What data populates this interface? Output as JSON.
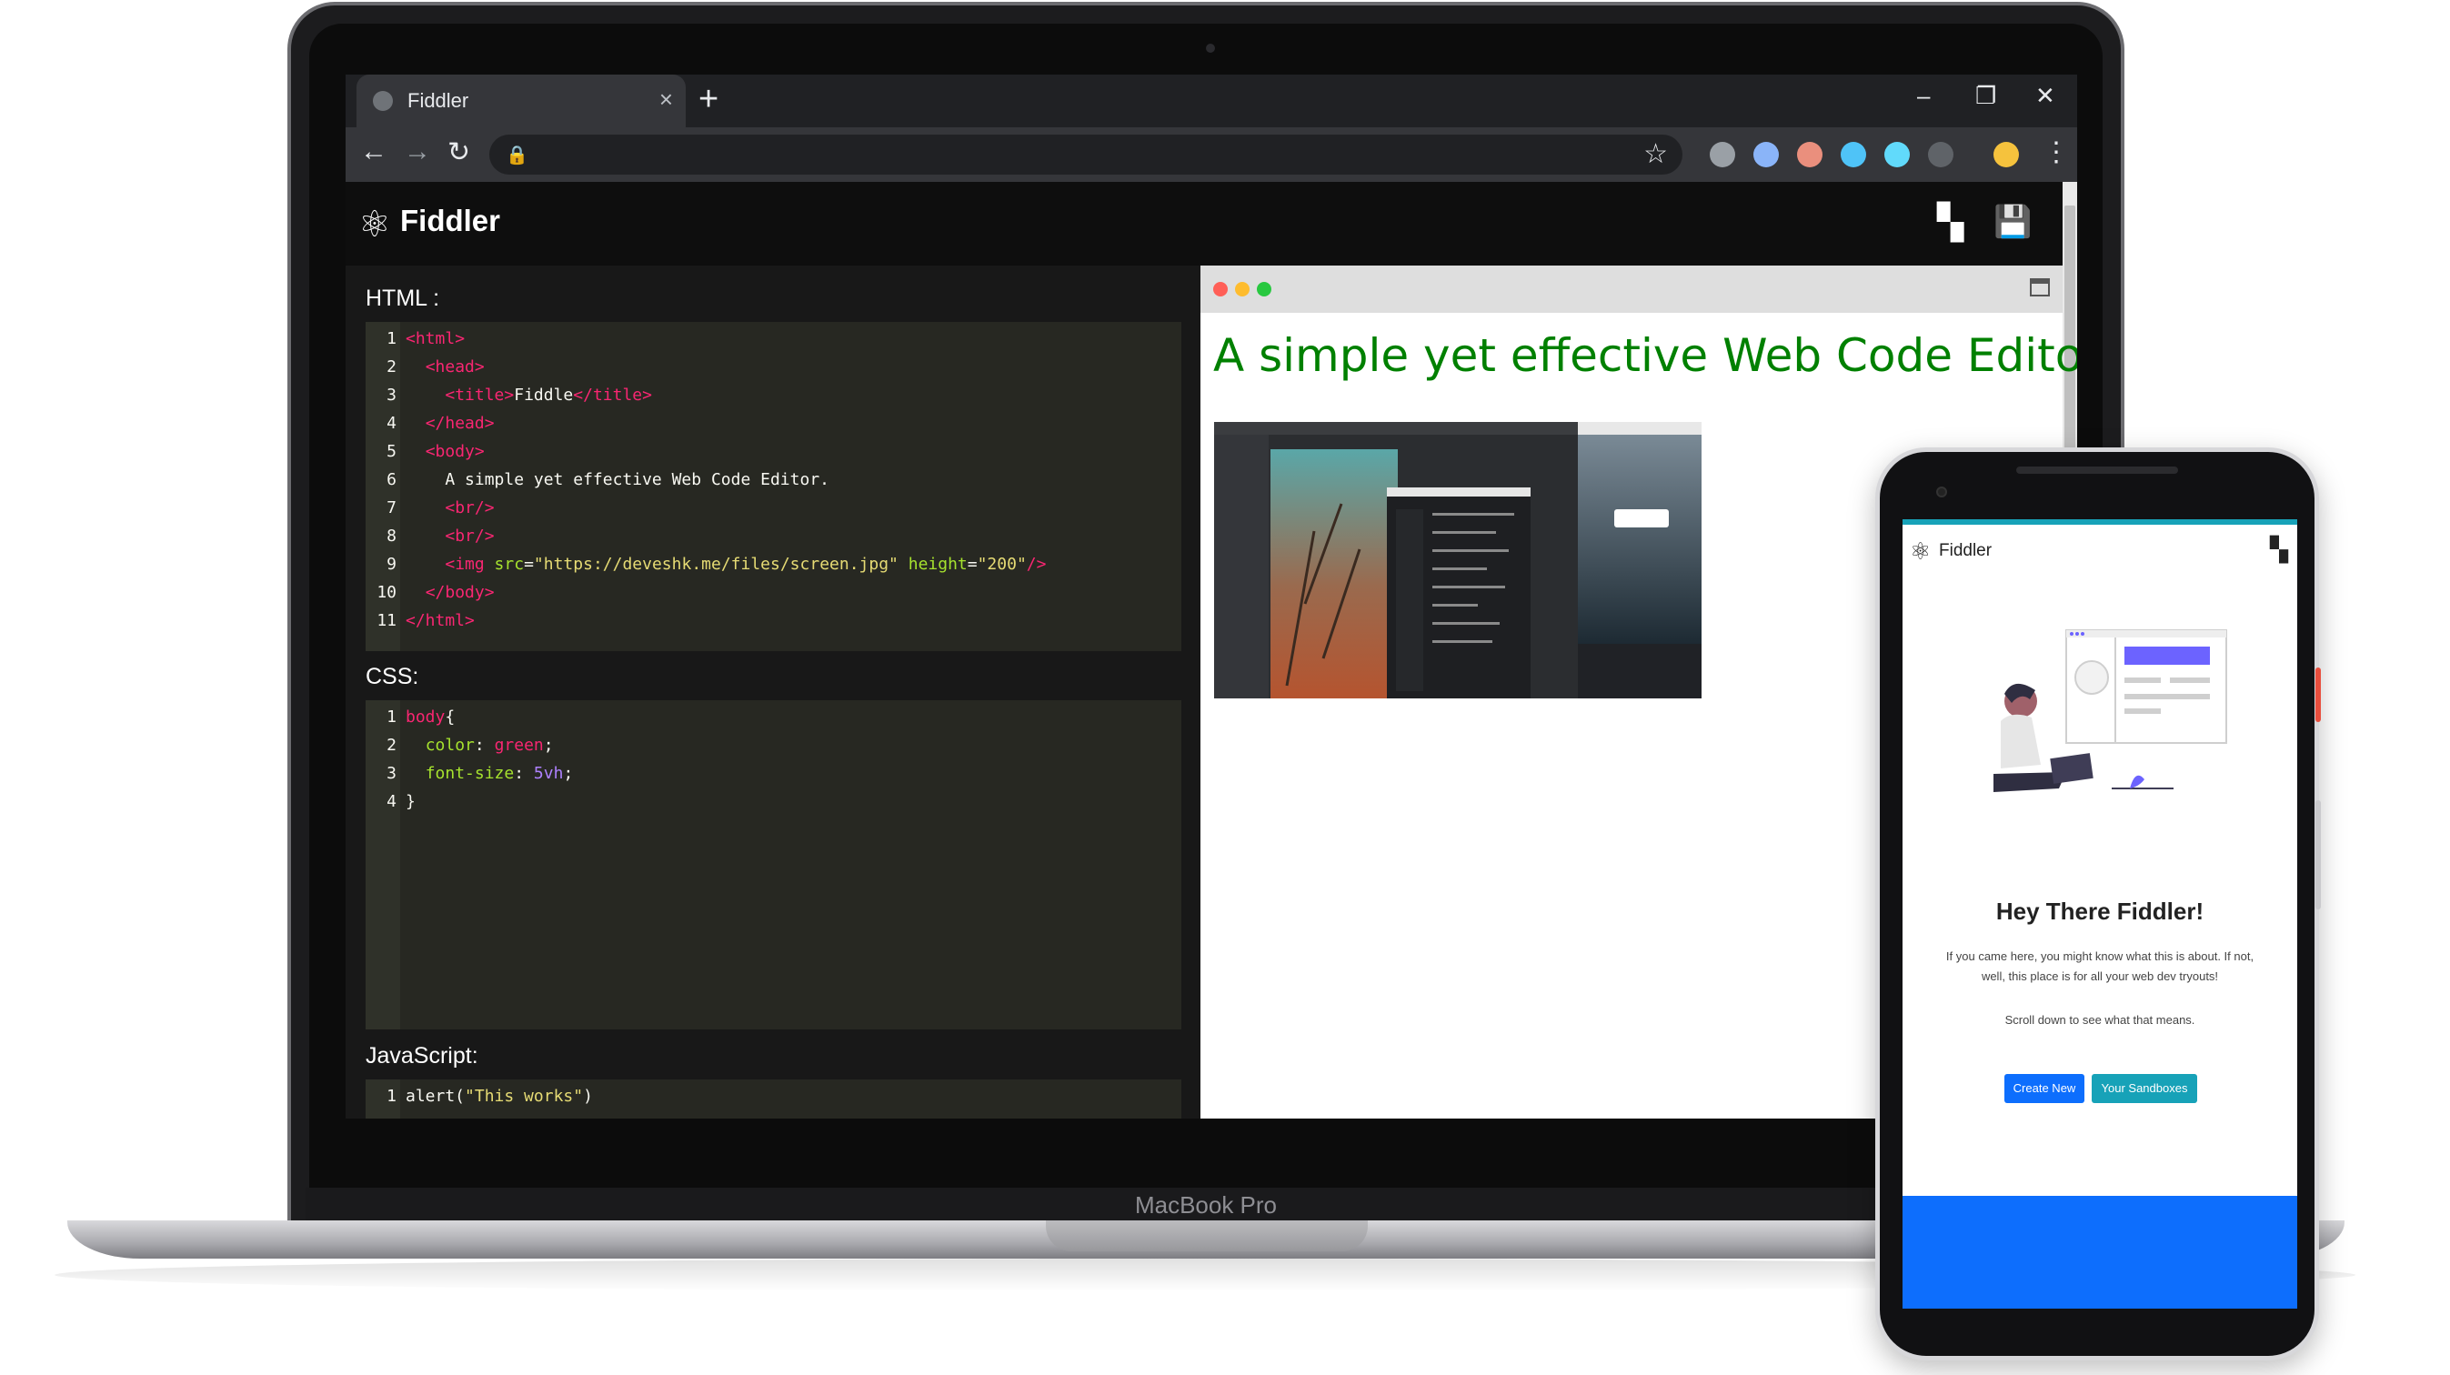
{
  "browser": {
    "tab_title": "Fiddler",
    "tab_close": "×",
    "new_tab": "+",
    "win_min": "–",
    "win_restore": "❐",
    "win_close": "✕",
    "back": "←",
    "forward": "→",
    "reload": "↻",
    "lock": "🔒",
    "star": "☆",
    "menu": "⋮",
    "extension_colors": [
      "#9aa0a6",
      "#8ab4f8",
      "#ea8f7d",
      "#4fc3f7",
      "#61dafb",
      "#5f6368",
      "#f5c23d"
    ]
  },
  "app": {
    "logo_icon": "⚛",
    "title": "Fiddler",
    "boxes_icon": "▚",
    "save_icon": "💾"
  },
  "editor": {
    "html_label": "HTML :",
    "css_label": "CSS:",
    "js_label": "JavaScript:",
    "html_lines": [
      "<html>",
      "  <head>",
      "    <title>Fiddle</title>",
      "  </head>",
      "  <body>",
      "    A simple yet effective Web Code Editor.",
      "    <br/>",
      "    <br/>",
      "    <img src=\"https://deveshk.me/files/screen.jpg\" height=\"200\"/>",
      "  </body>",
      "</html>"
    ],
    "css_lines": [
      "body{",
      "  color: green;",
      "  font-size: 5vh;",
      "}"
    ],
    "js_lines": [
      "alert(\"This works\")"
    ]
  },
  "preview": {
    "heading": "A simple yet effective Web Code Editor.",
    "traffic_colors": [
      "#ff5f57",
      "#febc2e",
      "#28c840"
    ]
  },
  "laptop": {
    "label": "MacBook Pro"
  },
  "phone": {
    "logo_icon": "⚛",
    "title": "Fiddler",
    "boxes_icon": "▚",
    "heading": "Hey There Fiddler!",
    "intro": "If you came here, you might know what this is about. If not, well, this place is for all your web dev tryouts!",
    "scroll_text": "Scroll down to see what that means.",
    "create_button": "Create New",
    "sandboxes_button": "Your Sandboxes",
    "create_color": "#0d6efd",
    "sandboxes_color": "#17a2b8"
  }
}
